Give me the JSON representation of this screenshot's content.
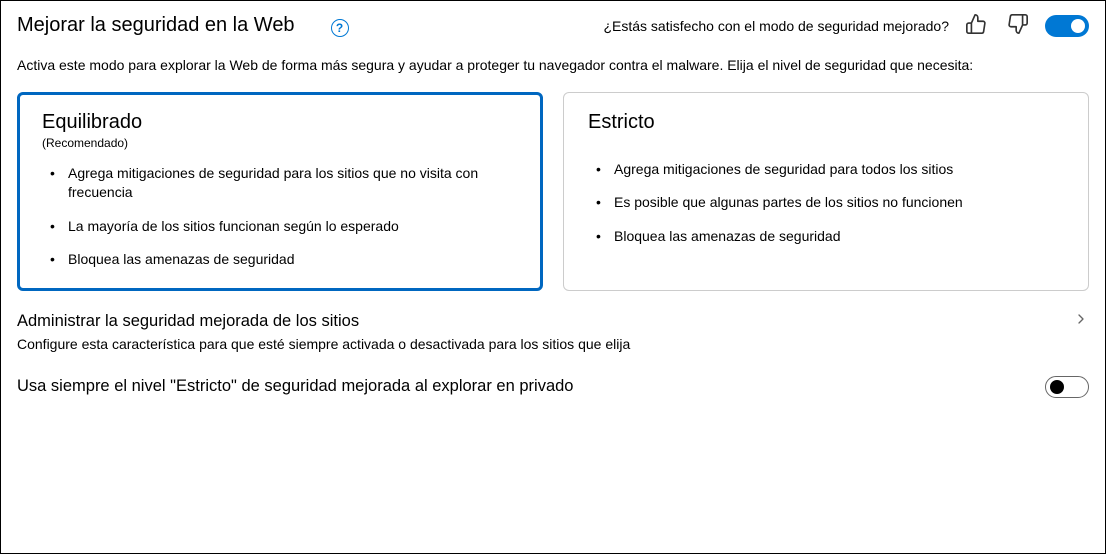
{
  "header": {
    "title": "Mejorar la seguridad en la Web",
    "feedback_prompt": "¿Estás satisfecho con el modo de seguridad mejorado?",
    "main_toggle_on": true
  },
  "description": "Activa este modo para explorar la Web de forma más segura y ayudar a proteger tu navegador contra el malware. Elija el nivel de seguridad que necesita:",
  "cards": {
    "balanced": {
      "title": "Equilibrado",
      "subtitle": "(Recomendado)",
      "items": [
        "Agrega mitigaciones de seguridad para los sitios que no visita con frecuencia",
        "La mayoría de los sitios funcionan según lo esperado",
        "Bloquea las amenazas de seguridad"
      ],
      "selected": true
    },
    "strict": {
      "title": "Estricto",
      "items": [
        "Agrega mitigaciones de seguridad para todos los sitios",
        "Es posible que algunas partes de los sitios no funcionen",
        "Bloquea las amenazas de seguridad"
      ],
      "selected": false
    }
  },
  "manage": {
    "title": "Administrar la seguridad mejorada de los sitios",
    "description": "Configure esta característica para que esté siempre activada o desactivada para los sitios que elija"
  },
  "strict_private": {
    "label": "Usa siempre el nivel \"Estricto\" de seguridad mejorada al explorar en privado",
    "toggle_on": false
  }
}
